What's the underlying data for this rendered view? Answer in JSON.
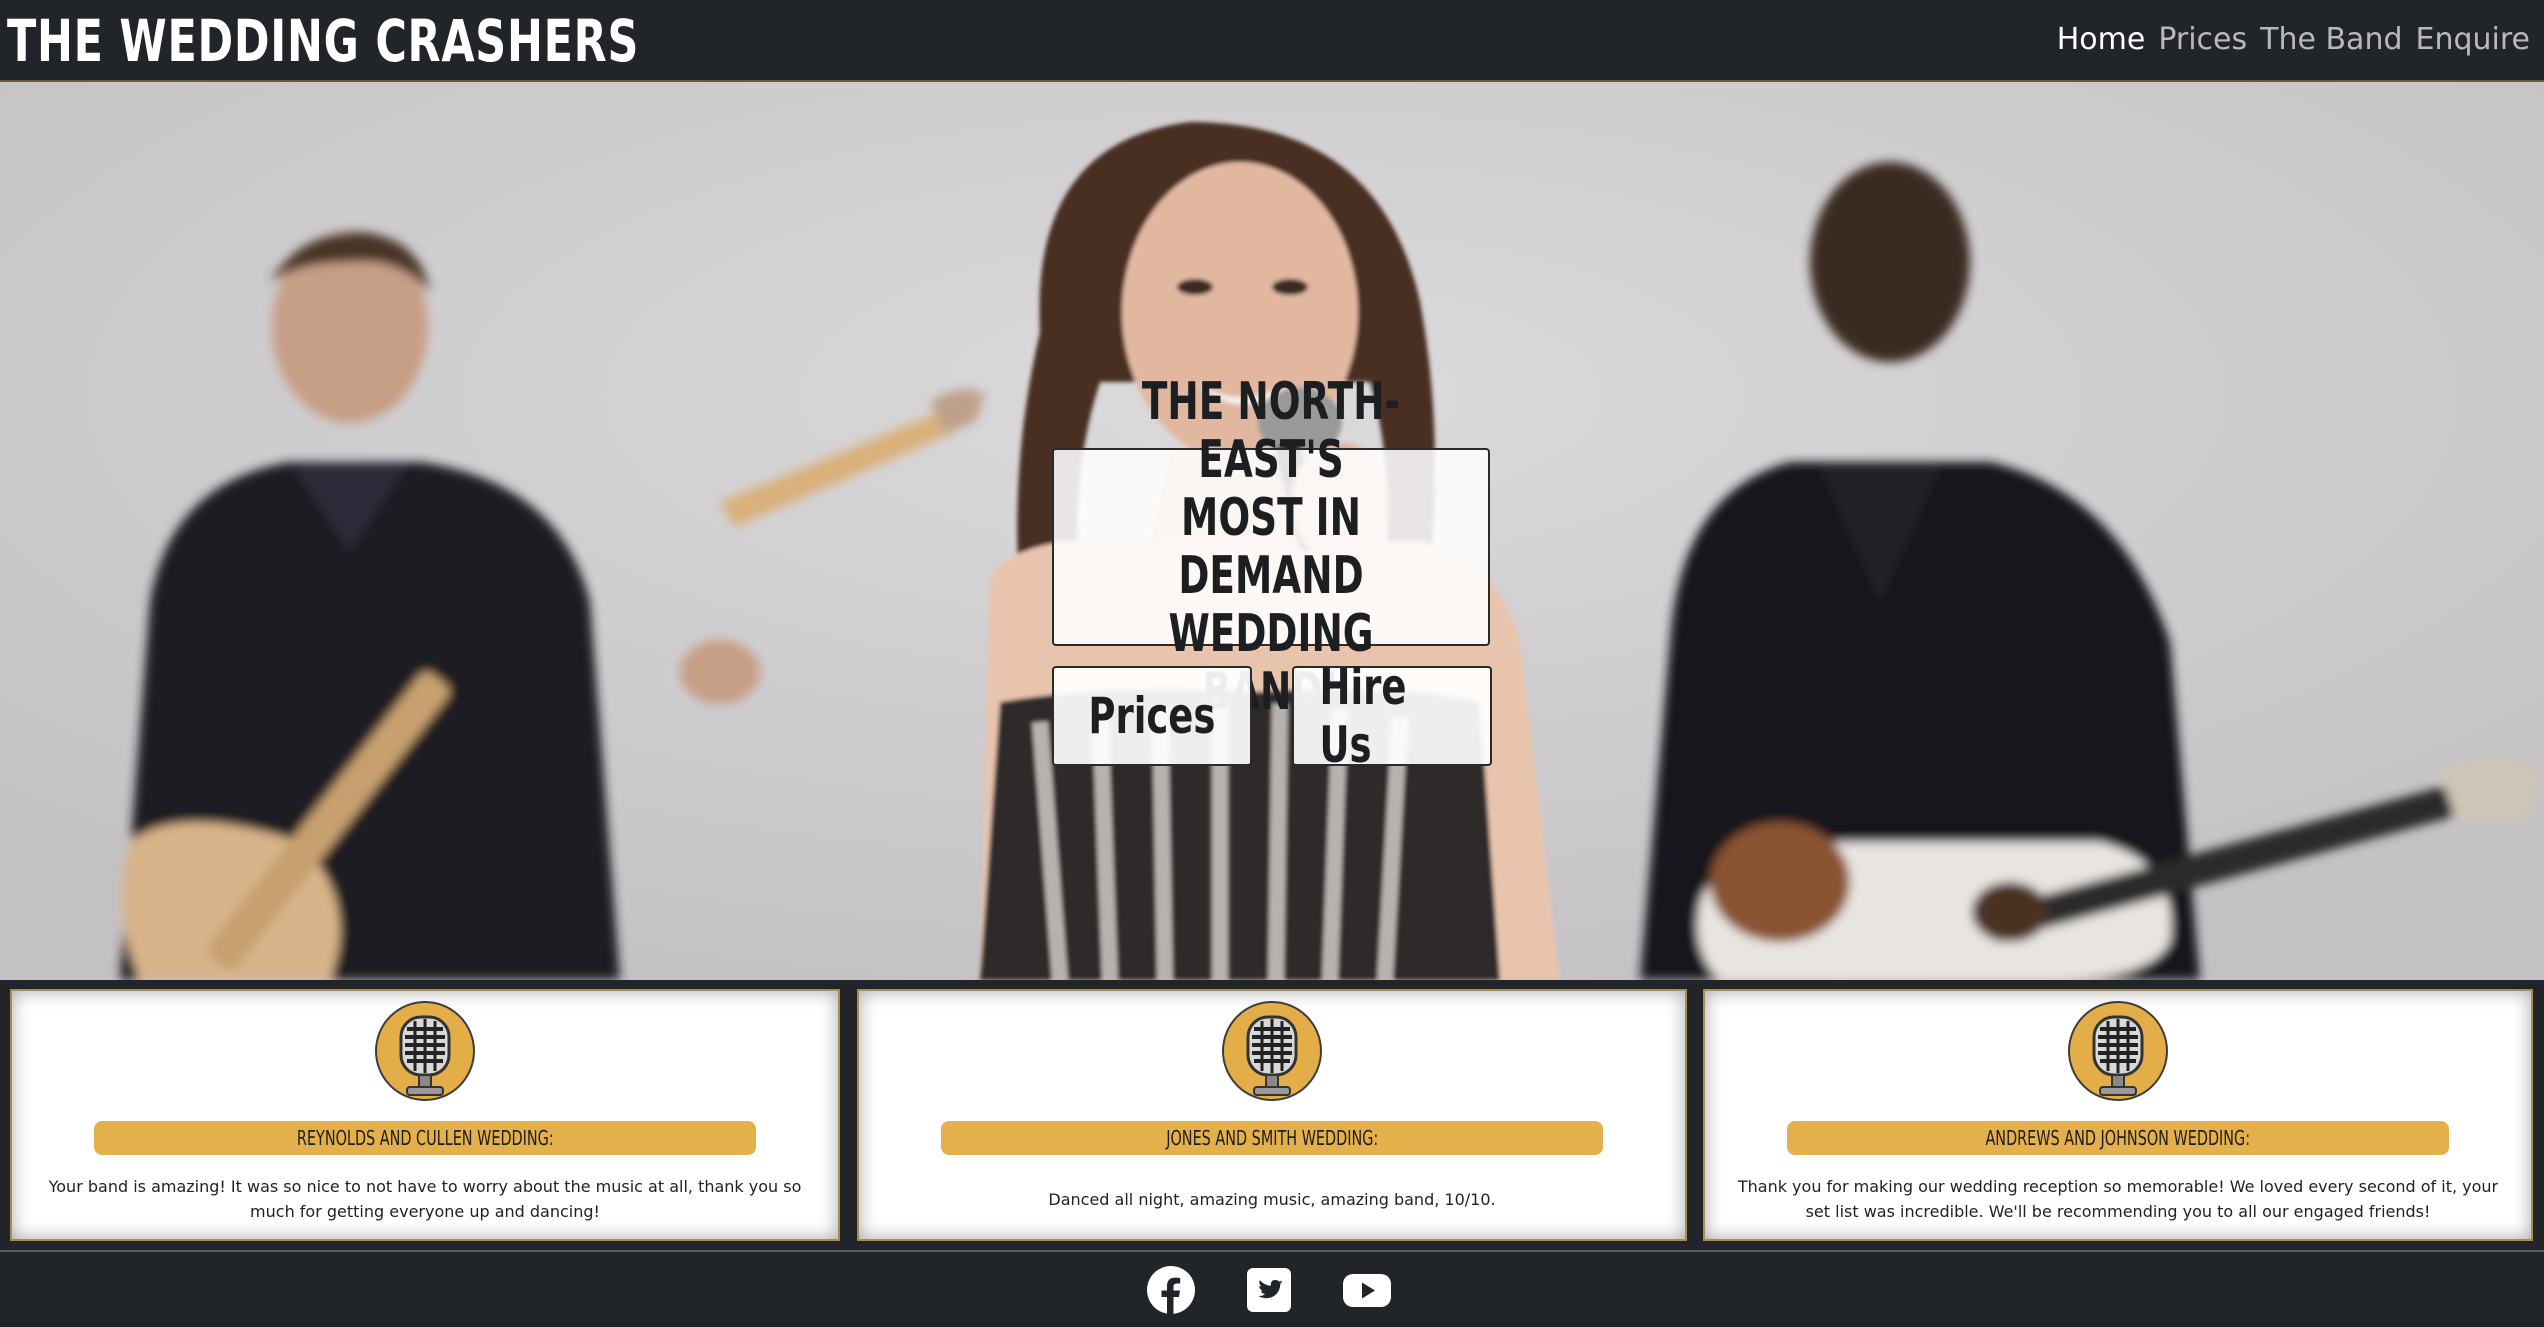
{
  "header": {
    "brand": "THE WEDDING CRASHERS",
    "nav": [
      {
        "label": "Home",
        "active": true
      },
      {
        "label": "Prices",
        "active": false
      },
      {
        "label": "The Band",
        "active": false
      },
      {
        "label": "Enquire",
        "active": false
      }
    ]
  },
  "hero": {
    "headline": "THE NORTH-EAST'S\nMOST IN DEMAND\nWEDDING BAND!",
    "buttons": {
      "prices": "Prices",
      "hire": "Hire Us"
    }
  },
  "testimonials": [
    {
      "icon": "microphone-icon",
      "title": "REYNOLDS AND CULLEN WEDDING:",
      "text": "Your band is amazing! It was so nice to not have to worry about the music at all, thank you so much for getting everyone up and dancing!"
    },
    {
      "icon": "microphone-icon",
      "title": "JONES AND SMITH WEDDING:",
      "text": "Danced all night, amazing music, amazing band, 10/10."
    },
    {
      "icon": "microphone-icon",
      "title": "ANDREWS AND JOHNSON WEDDING:",
      "text": "Thank you for making our wedding reception so memorable! We loved every second of it, your set list was incredible. We'll be recommending you to all our engaged friends!"
    }
  ],
  "footer": {
    "social": [
      "facebook-icon",
      "twitter-icon",
      "youtube-icon"
    ]
  },
  "colors": {
    "background": "#212428",
    "accent_gold": "#e3b04c",
    "text_light": "#ffffff",
    "nav_inactive": "#b9b9b9"
  }
}
